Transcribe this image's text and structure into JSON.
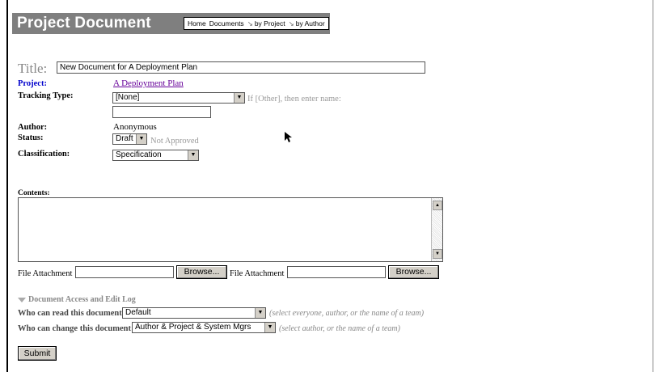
{
  "header": {
    "title": "Project Document",
    "nav": [
      "Home",
      "Documents",
      "by Project",
      "by Author"
    ]
  },
  "form": {
    "title_label": "Title:",
    "title_value": "New Document for A Deployment Plan",
    "project_label": "Project:",
    "project_value": "A Deployment Plan",
    "tracking_label": "Tracking Type:",
    "tracking_value": "[None]",
    "tracking_hint": "If [Other], then enter name:",
    "author_label": "Author:",
    "author_value": "Anonymous",
    "status_label": "Status:",
    "status_value": "Draft",
    "status_hint": "Not Approved",
    "classification_label": "Classification:",
    "classification_value": "Specification",
    "contents_label": "Contents:",
    "attachment_label": "File Attachment",
    "browse_label": "Browse..."
  },
  "access": {
    "section_label": "Document Access and Edit Log",
    "read_label": "Who can read this document:",
    "read_value": "Default",
    "read_note": "(select everyone, author, or the name of a team)",
    "change_label": "Who can change this document:",
    "change_value": "Author & Project & System Mgrs",
    "change_note": "(select author, or the name of a team)"
  },
  "submit_label": "Submit"
}
